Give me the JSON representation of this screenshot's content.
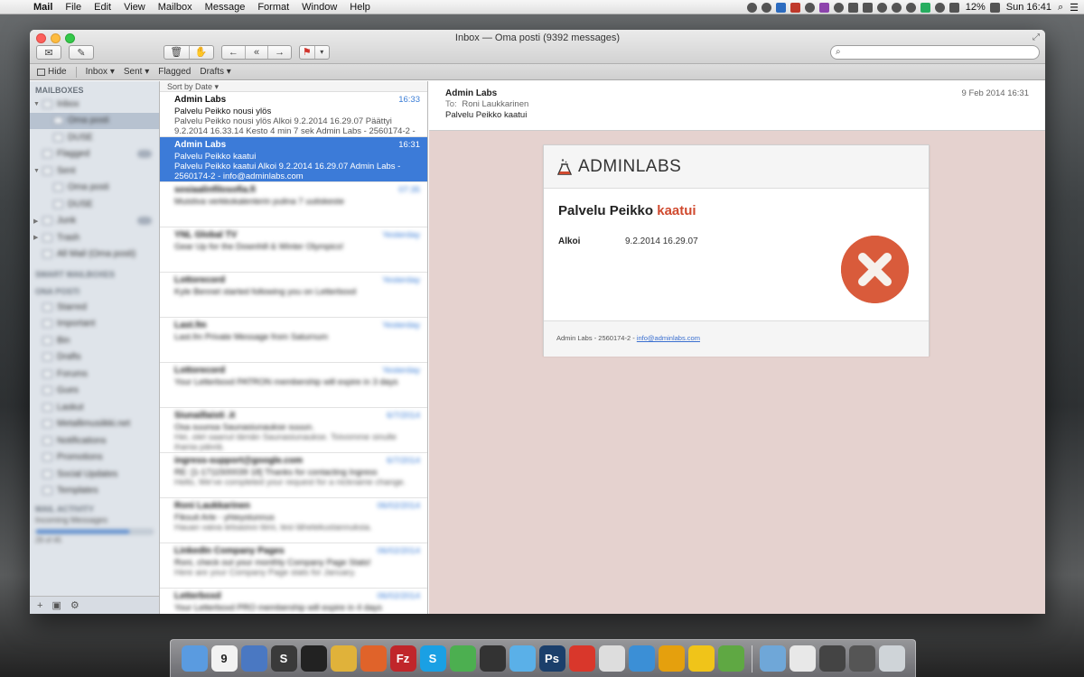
{
  "menubar": {
    "app": "Mail",
    "items": [
      "File",
      "Edit",
      "View",
      "Mailbox",
      "Message",
      "Format",
      "Window",
      "Help"
    ],
    "battery": "12%",
    "clock": "Sun 16:41"
  },
  "window": {
    "title": "Inbox — Oma posti (9392 messages)"
  },
  "toolbar": {
    "get_mail_icon": "envelope-icon",
    "compose_icon": "compose-icon",
    "delete_icon": "trash-icon",
    "junk_icon": "thumbs-down-icon",
    "reply_icon": "reply-arrow-icon",
    "reply_all_icon": "reply-all-arrow-icon",
    "forward_icon": "forward-arrow-icon",
    "flag_icon": "flag-icon",
    "search_placeholder": ""
  },
  "favorites": {
    "hide": "Hide",
    "inbox": "Inbox ▾",
    "sent": "Sent ▾",
    "flagged": "Flagged",
    "drafts": "Drafts ▾"
  },
  "sidebar": {
    "header": "MAILBOXES",
    "items": [
      {
        "label": "Inbox",
        "level": 0
      },
      {
        "label": "Oma posti",
        "level": 1
      },
      {
        "label": "DUSE",
        "level": 1
      },
      {
        "label": "Flagged",
        "level": 0
      },
      {
        "label": "Sent",
        "level": 0
      },
      {
        "label": "Oma posti",
        "level": 1
      },
      {
        "label": "DUSE",
        "level": 1
      },
      {
        "label": "Junk",
        "level": 0
      },
      {
        "label": "Trash",
        "level": 0
      },
      {
        "label": "All Mail (Oma posti)",
        "level": 0
      }
    ],
    "section2": "SMART MAILBOXES",
    "section3": "ONA POSTI",
    "folders": [
      "Starred",
      "Important",
      "Bin",
      "Drafts",
      "Forums",
      "Gues",
      "Laskut",
      "Metallimusiikki.net",
      "Notifications",
      "Promotions",
      "Social Updates",
      "Templates"
    ],
    "activity_header": "MAIL ACTIVITY",
    "activity_label": "Incoming Messages",
    "activity_count": "29 of 45",
    "activity_progress": 0.8
  },
  "list": {
    "sort_label": "Sort by Date ▾",
    "messages": [
      {
        "from": "Admin Labs",
        "time": "16:33",
        "subject": "Palvelu Peikko nousi ylös",
        "preview": "Palvelu Peikko nousi ylös Alkoi 9.2.2014 16.29.07 Päättyi 9.2.2014 16.33.14 Kesto 4 min 7 sek Admin Labs - 2560174-2 - info@admin...",
        "blurred": false,
        "selected": false
      },
      {
        "from": "Admin Labs",
        "time": "16:31",
        "subject": "Palvelu Peikko kaatui",
        "preview": "Palvelu Peikko kaatui Alkoi 9.2.2014 16.29.07 Admin Labs - 2560174-2 - info@adminlabs.com",
        "blurred": false,
        "selected": true
      },
      {
        "from": "sosiaalinfilosofia.fi",
        "time": "07:35",
        "subject": "Muistiva verkkokalenterin pulina 7 uutiskeste",
        "preview": "",
        "blurred": true,
        "selected": false
      },
      {
        "from": "YNL Global TV",
        "time": "Yesterday",
        "subject": "Gear Up for the Downhill & Winter Olympics!",
        "preview": "",
        "blurred": true,
        "selected": false
      },
      {
        "from": "Lottorecord",
        "time": "Yesterday",
        "subject": "Kyle Bennet started following you on Letterboxd",
        "preview": "",
        "blurred": true,
        "selected": false
      },
      {
        "from": "Last.fm",
        "time": "Yesterday",
        "subject": "Last.fm Private Message from Saturnum",
        "preview": "",
        "blurred": true,
        "selected": false
      },
      {
        "from": "Lottorecord",
        "time": "Yesterday",
        "subject": "Your Letterboxd PATRON membership will expire in 3 days",
        "preview": "",
        "blurred": true,
        "selected": false
      },
      {
        "from": "Siunaillaisti .it",
        "time": "6/7/2014",
        "subject": "Osa suunsa Saunasiunaukse suuun.",
        "preview": "Hei, olet saanut tämän Saunasiunaukse. Toivomme sinulle ihania päiviä.",
        "blurred": true,
        "selected": false
      },
      {
        "from": "ingress-support@google.com",
        "time": "6/7/2014",
        "subject": "RE: [1-1711500039 18] Thanks for contacting Ingress",
        "preview": "Hello, We've completed your request for a nickname change.",
        "blurred": true,
        "selected": false
      },
      {
        "from": "Roni Laukkarinen",
        "time": "06/02/2014",
        "subject": "Fiksuit Arle - yhteystunnus",
        "preview": "Hauan vaiva ietsasivo tiimi, tesi lähetekustannuksia.",
        "blurred": true,
        "selected": false
      },
      {
        "from": "LinkedIn Company Pages",
        "time": "06/02/2014",
        "subject": "Roni, check out your monthly Company Page Stats!",
        "preview": "Here are your Company Page stats for January.",
        "blurred": true,
        "selected": false
      },
      {
        "from": "Letterboxd",
        "time": "06/02/2014",
        "subject": "Your Letterboxd PRO membership will expire in 4 days",
        "preview": "",
        "blurred": true,
        "selected": false
      }
    ]
  },
  "reader": {
    "from": "Admin Labs",
    "to_label": "To:",
    "to": "Roni Laukkarinen",
    "subject": "Palvelu Peikko kaatui",
    "date": "9 Feb 2014 16:31",
    "card": {
      "logo": "ADMINLABS",
      "title_prefix": "Palvelu Peikko",
      "title_accent": "kaatui",
      "row_key": "Alkoi",
      "row_value": "9.2.2014 16.29.07",
      "footer_text": "Admin Labs - 2560174-2 - ",
      "footer_link": "info@adminlabs.com"
    }
  },
  "dock": {
    "apps": [
      {
        "name": "finder-icon",
        "color": "#5a9be0"
      },
      {
        "name": "calendar-icon",
        "color": "#f2f2f2",
        "label": "9"
      },
      {
        "name": "xcode-icon",
        "color": "#4a78c2"
      },
      {
        "name": "sublime-icon",
        "color": "#3a3a3a",
        "label": "S"
      },
      {
        "name": "terminal-icon",
        "color": "#222"
      },
      {
        "name": "chrome-icon",
        "color": "#e0b23a"
      },
      {
        "name": "firefox-icon",
        "color": "#e0632a"
      },
      {
        "name": "filezilla-icon",
        "color": "#c0262a",
        "label": "Fz"
      },
      {
        "name": "skype-icon",
        "color": "#1aa0e4",
        "label": "S"
      },
      {
        "name": "spotify-icon",
        "color": "#4caf50"
      },
      {
        "name": "sequel-icon",
        "color": "#333"
      },
      {
        "name": "cloud-icon",
        "color": "#5ab0e8"
      },
      {
        "name": "photoshop-icon",
        "color": "#1b3f6b",
        "label": "Ps"
      },
      {
        "name": "power-icon",
        "color": "#d9372b"
      },
      {
        "name": "preview-icon",
        "color": "#ddd"
      },
      {
        "name": "tweetbot-icon",
        "color": "#3b8fd6"
      },
      {
        "name": "plex-icon",
        "color": "#e5a00d"
      },
      {
        "name": "colorpicker-icon",
        "color": "#f0c419"
      },
      {
        "name": "evernote-icon",
        "color": "#5fa843"
      },
      {
        "name": "applications-folder-icon",
        "color": "#6fa7d8"
      },
      {
        "name": "document-icon",
        "color": "#e8e8e8"
      },
      {
        "name": "screenshot-icon",
        "color": "#444"
      },
      {
        "name": "screen-icon",
        "color": "#555"
      },
      {
        "name": "trash-icon",
        "color": "#cfd4d8"
      }
    ]
  },
  "colors": {
    "selection": "#3c7bd8",
    "accent_red": "#d04a2f",
    "reader_bg": "#e5d2cf"
  }
}
